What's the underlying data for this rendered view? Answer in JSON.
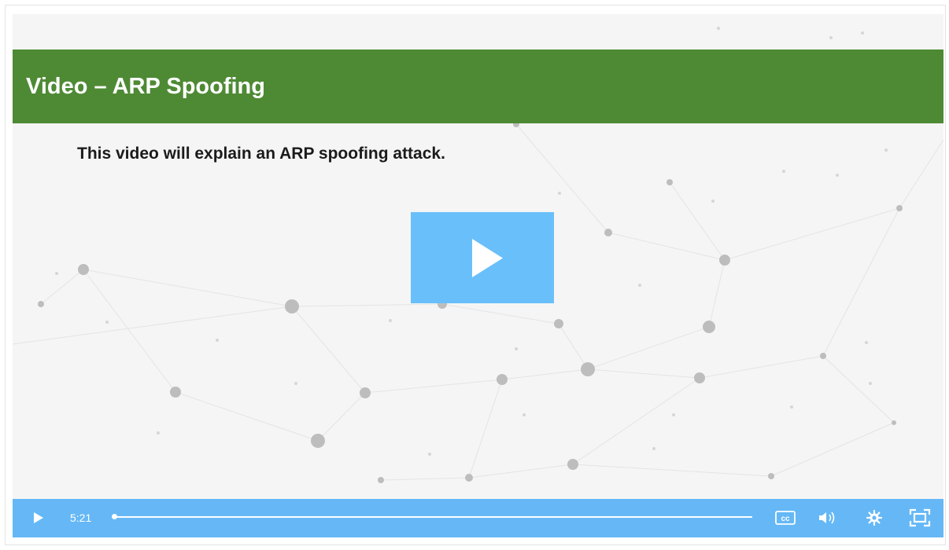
{
  "slide": {
    "title": "Video – ARP Spoofing",
    "subtitle": "This video will explain an ARP spoofing attack."
  },
  "player": {
    "time": "5:21",
    "progress_fraction": 0.0,
    "controls": {
      "play": "play-icon",
      "captions": "cc-icon",
      "volume": "volume-icon",
      "settings": "gear-icon",
      "fullscreen": "fullscreen-icon"
    }
  },
  "colors": {
    "header": "#4e8a34",
    "control_bar": "#65b8f5",
    "big_play": "#69bffa"
  }
}
